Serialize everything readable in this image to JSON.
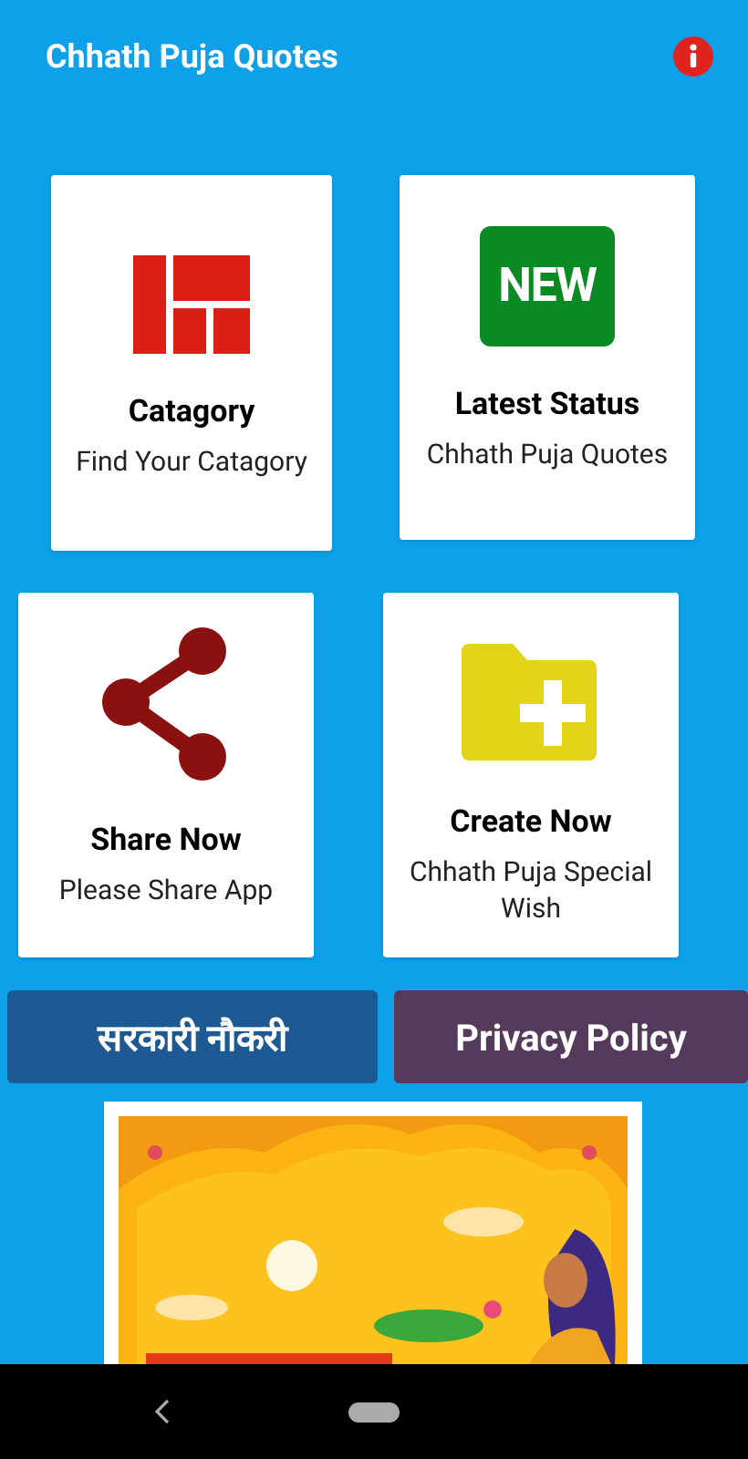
{
  "app_bar": {
    "title": "Chhath Puja Quotes"
  },
  "cards": [
    {
      "kind": "layout",
      "title": "Catagory",
      "subtitle": "Find Your Catagory"
    },
    {
      "kind": "new",
      "badge": "NEW",
      "title": "Latest Status",
      "subtitle": "Chhath Puja Quotes"
    },
    {
      "kind": "share",
      "title": "Share Now",
      "subtitle": "Please Share App"
    },
    {
      "kind": "folder",
      "title": "Create Now",
      "subtitle": "Chhath Puja Special Wish"
    }
  ],
  "buttons": [
    {
      "label": "सरकारी नौकरी",
      "color": "#1d5a93"
    },
    {
      "label": "Privacy Policy",
      "color": "#563a5c"
    }
  ]
}
